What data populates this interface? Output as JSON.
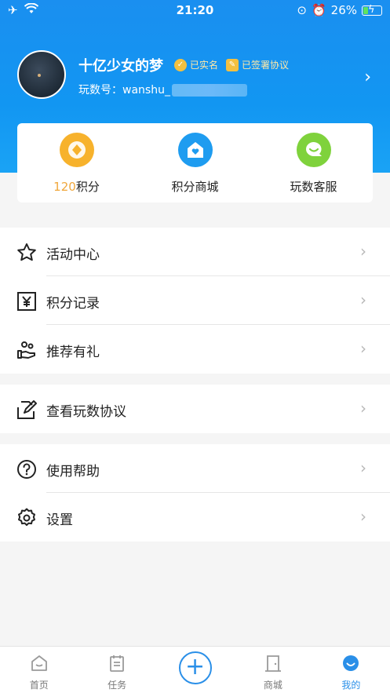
{
  "status": {
    "time": "21:20",
    "battery": "26%"
  },
  "profile": {
    "nickname": "十亿少女的梦",
    "badge_realname": "已实名",
    "badge_agreement": "已签署协议",
    "account_prefix": "玩数号：wanshu_"
  },
  "card": {
    "points_value": "120",
    "points_label": "积分",
    "mall_label": "积分商城",
    "service_label": "玩数客服"
  },
  "menu": {
    "activity": "活动中心",
    "points_record": "积分记录",
    "referral": "推荐有礼",
    "agreement": "查看玩数协议",
    "help": "使用帮助",
    "settings": "设置"
  },
  "tabs": {
    "home": "首页",
    "tasks": "任务",
    "mall": "商城",
    "mine": "我的"
  },
  "colors": {
    "primary": "#1a8ff0",
    "points": "#f0a73c",
    "mall_icon": "#1e9cf0",
    "service_icon": "#7fd23c"
  }
}
